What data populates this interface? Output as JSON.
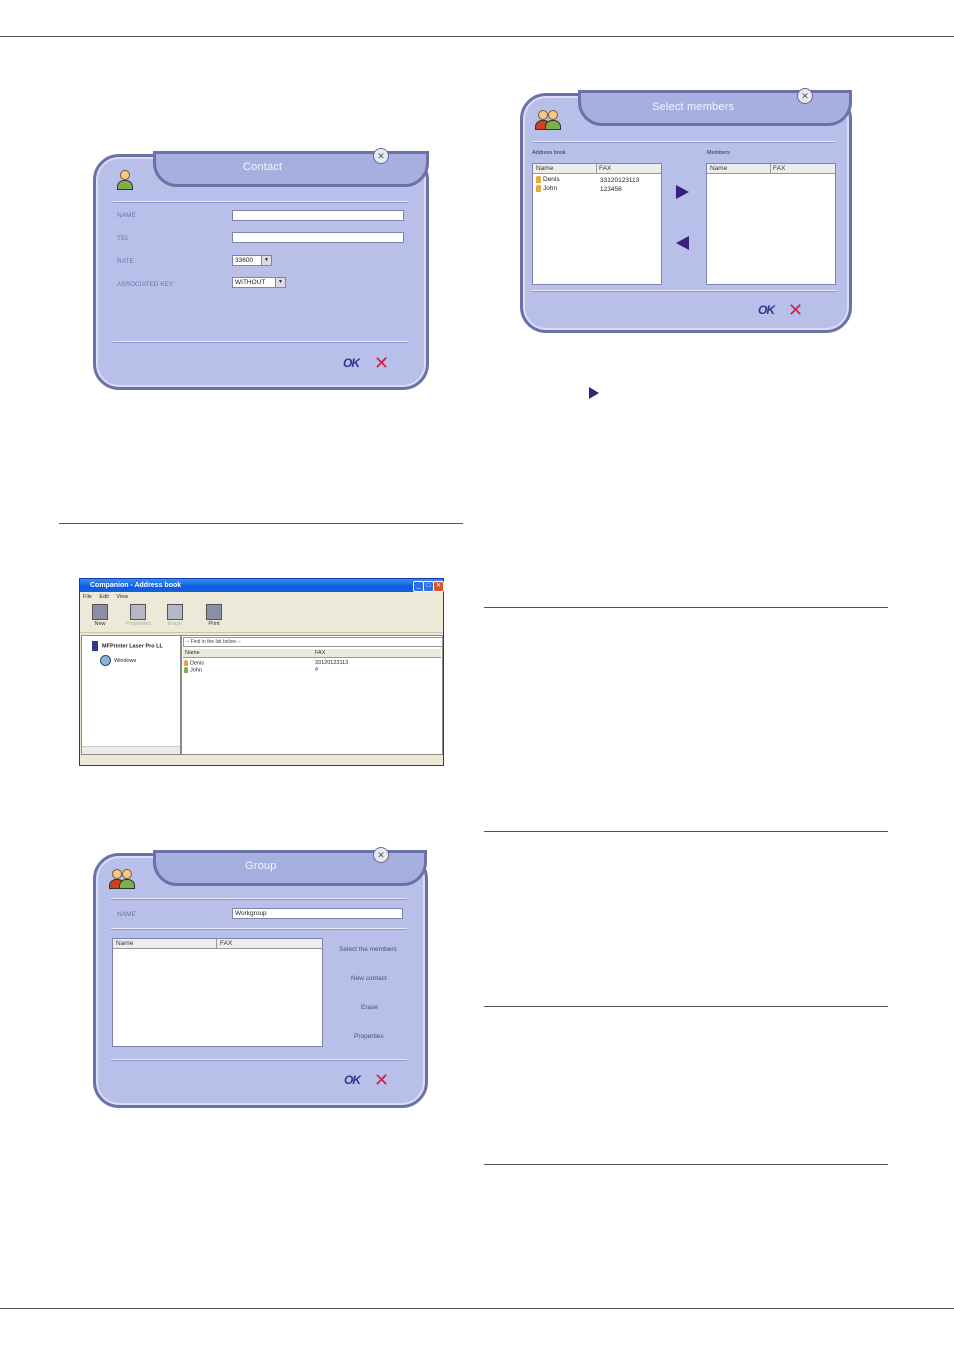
{
  "contact_dialog": {
    "title": "Contact",
    "labels": {
      "name": "NAME",
      "tel": "TEL",
      "rate": "RATE",
      "associated_key": "ASSOCIATED KEY"
    },
    "rate_value": "33600",
    "associated_key_value": "WITHOUT",
    "ok_label": "OK",
    "cancel_label": "✕"
  },
  "select_members_dialog": {
    "title": "Select members",
    "address_book_label": "Address book",
    "members_label": "Members",
    "columns": [
      "Name",
      "FAX"
    ],
    "address_book_rows": [
      {
        "name": "Denis",
        "fax": "33120123113"
      },
      {
        "name": "John",
        "fax": "123456"
      }
    ],
    "ok_label": "OK",
    "cancel_label": "✕"
  },
  "address_book_window": {
    "title": "Companion - Address book",
    "menu": [
      "File",
      "Edit",
      "View"
    ],
    "toolbar": [
      {
        "label": "New"
      },
      {
        "label": "Properties"
      },
      {
        "label": "Erase"
      },
      {
        "label": "Print"
      }
    ],
    "tree": [
      "MFPrinter Laser Pro LL",
      "Windows"
    ],
    "find_placeholder": "-- Find in the list below --",
    "columns": [
      "Name",
      "FAX"
    ],
    "rows": [
      {
        "name": "Denis",
        "fax": "33120123113"
      },
      {
        "name": "John",
        "fax": "#"
      }
    ]
  },
  "group_dialog": {
    "title": "Group",
    "name_label": "NAME",
    "name_value": "Workgroup",
    "columns": [
      "Name",
      "FAX"
    ],
    "actions": [
      "Select the members",
      "New contact",
      "Erase",
      "Properties"
    ],
    "ok_label": "OK",
    "cancel_label": "✕"
  },
  "colors": {
    "dialog_bg": "#b8bfe8",
    "dialog_border": "#6b72a8",
    "arrow": "#3b1f7a",
    "cancel": "#cc2244"
  }
}
